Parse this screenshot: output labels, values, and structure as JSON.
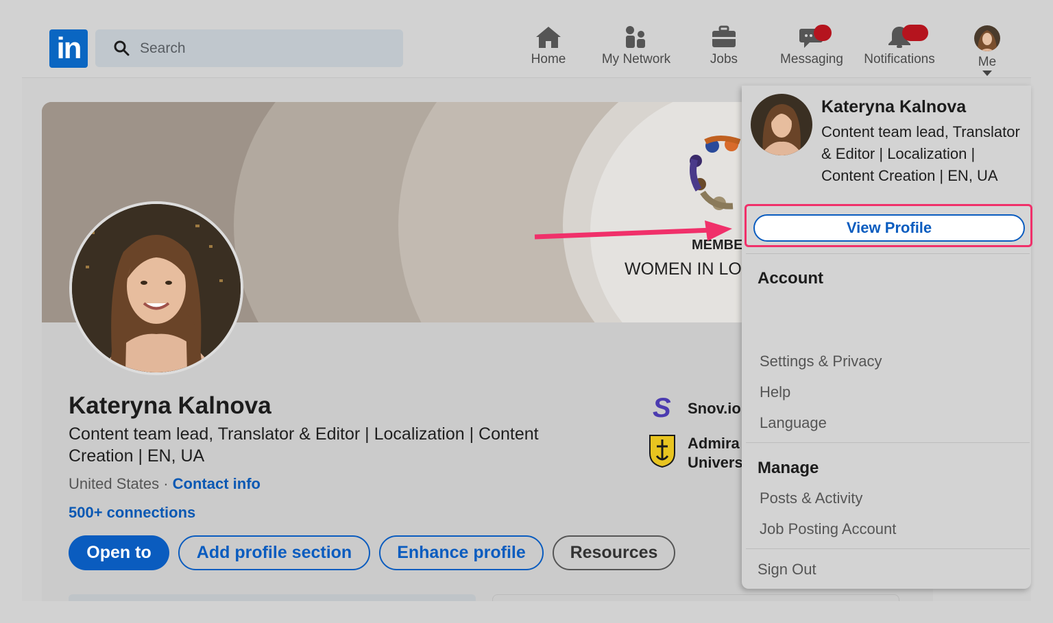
{
  "nav": {
    "logo": "in",
    "search_placeholder": "Search",
    "items": [
      {
        "label": "Home",
        "icon": "home-icon"
      },
      {
        "label": "My Network",
        "icon": "network-icon"
      },
      {
        "label": "Jobs",
        "icon": "briefcase-icon"
      },
      {
        "label": "Messaging",
        "icon": "messaging-icon"
      },
      {
        "label": "Notifications",
        "icon": "bell-icon"
      },
      {
        "label": "Me",
        "icon": "avatar"
      }
    ]
  },
  "banner": {
    "line1": "MEMBE",
    "line2": "WOMEN IN LO"
  },
  "profile": {
    "name": "Kateryna Kalnova",
    "headline": "Content team lead, Translator & Editor | Localization | Content Creation | EN, UA",
    "location": "United States",
    "separator": "·",
    "contact_info": "Contact info",
    "connections": "500+ connections",
    "companies": [
      {
        "name": "Snov.io",
        "logo": "S"
      },
      {
        "name_line1": "Admira",
        "name_line2": "Univers"
      }
    ]
  },
  "buttons": {
    "open_to": "Open to",
    "add_section": "Add profile section",
    "enhance": "Enhance profile",
    "resources": "Resources"
  },
  "dropdown": {
    "name": "Kateryna Kalnova",
    "headline": "Content team lead, Translator & Editor | Localization | Content Creation | EN, UA",
    "view_profile": "View Profile",
    "account_heading": "Account",
    "account_items": [
      "Settings & Privacy",
      "Help",
      "Language"
    ],
    "manage_heading": "Manage",
    "manage_items": [
      "Posts & Activity",
      "Job Posting Account"
    ],
    "sign_out": "Sign Out"
  },
  "colors": {
    "brand": "#0a66c2",
    "highlight": "#f0306a",
    "badge": "#b5141e"
  }
}
